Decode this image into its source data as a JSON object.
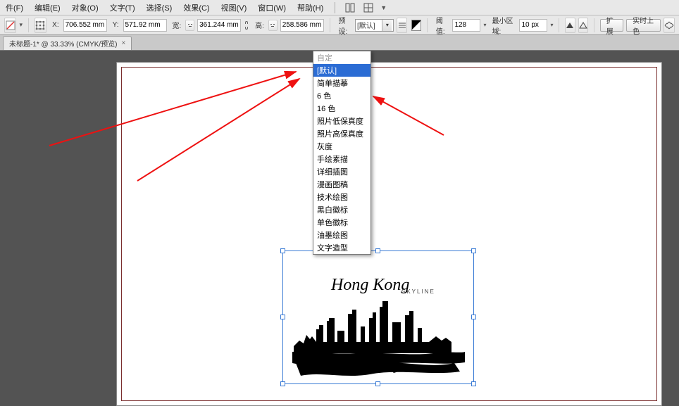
{
  "menubar": {
    "items": [
      "件(F)",
      "编辑(E)",
      "对象(O)",
      "文字(T)",
      "选择(S)",
      "效果(C)",
      "视图(V)",
      "窗口(W)",
      "帮助(H)"
    ]
  },
  "toolbar": {
    "x_label": "X:",
    "x_value": "706.552 mm",
    "y_label": "Y:",
    "y_value": "571.92 mm",
    "w_label": "宽:",
    "w_value": "361.244 mm",
    "h_label": "高:",
    "h_value": "258.586 mm",
    "preset_label": "预设:",
    "preset_value": "[默认]",
    "threshold_label": "阈值:",
    "threshold_value": "128",
    "minarea_label": "最小区域:",
    "minarea_value": "10 px",
    "expand_label": "扩展",
    "live_color_label": "实时上色"
  },
  "tab": {
    "title": "未标题-1* @ 33.33% (CMYK/预览)"
  },
  "dropdown": {
    "disabled": "自定",
    "items": [
      "[默认]",
      "简单描摹",
      "6 色",
      "16 色",
      "照片低保真度",
      "照片高保真度",
      "灰度",
      "手绘素描",
      "详细插图",
      "漫画图稿",
      "技术绘图",
      "黑白徽标",
      "单色徽标",
      "油墨绘图",
      "文字造型"
    ],
    "selected_index": 0
  },
  "artwork": {
    "script_text": "Hong Kong",
    "sub_text": "SKYLINE"
  }
}
